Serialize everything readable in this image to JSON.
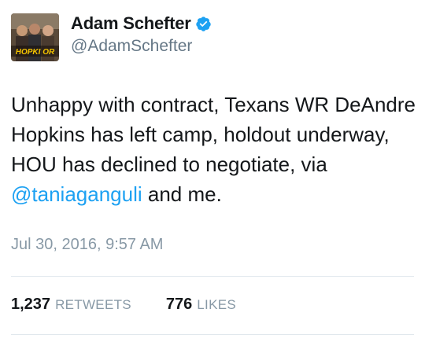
{
  "user": {
    "display_name": "Adam Schefter",
    "handle": "@AdamSchefter",
    "verified": true,
    "verified_icon": "verified-badge-icon",
    "avatar_caption": "HOPKI OR"
  },
  "tweet": {
    "text_before": "Unhappy with contract, Texans WR DeAndre Hopkins has left camp, holdout underway, HOU has declined to negotiate, via ",
    "mention": "@taniaganguli",
    "text_after": " and me.",
    "timestamp": "Jul 30, 2016, 9:57 AM"
  },
  "stats": {
    "retweets_count": "1,237",
    "retweets_label": "RETWEETS",
    "likes_count": "776",
    "likes_label": "LIKES"
  },
  "colors": {
    "link": "#1da1f2",
    "secondary_text": "#8899a6",
    "primary_text": "#14171a",
    "divider": "#e1e8ed"
  }
}
